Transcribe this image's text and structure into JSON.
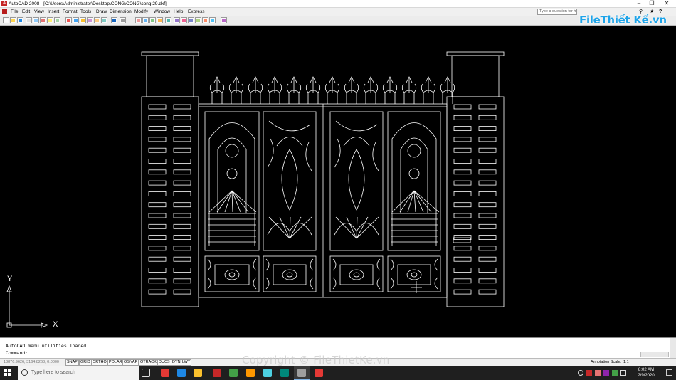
{
  "window": {
    "app_icon": "A",
    "title": "AutoCAD 2008 - [C:\\Users\\Administrator\\Desktop\\CONG\\CONG\\cong 29.dxf]",
    "minimize": "–",
    "restore": "❐",
    "close": "✕"
  },
  "menu": {
    "items": [
      "File",
      "Edit",
      "View",
      "Insert",
      "Format",
      "Tools",
      "Draw",
      "Dimension",
      "Modify",
      "Window",
      "Help",
      "Express"
    ],
    "help_search_placeholder": "Type a question for help"
  },
  "logo": {
    "text": "FileThiết Kế.vn"
  },
  "canvas": {
    "background": "#000000",
    "line_color": "#ffffff",
    "ucs_y": "Y",
    "ucs_x": "X"
  },
  "command": {
    "history": "AutoCAD menu utilities loaded.",
    "prompt": "Command:"
  },
  "status": {
    "coordinates": "13876.9626, 3164.8263, 0.0000",
    "toggles": [
      "SNAP",
      "GRID",
      "ORTHO",
      "POLAR",
      "OSNAP",
      "OTRACK",
      "DUCS",
      "DYN",
      "LWT"
    ],
    "annotation_scale_label": "Annotation Scale:",
    "annotation_scale_value": "1:1"
  },
  "taskbar": {
    "search_placeholder": "Type here to search",
    "time": "8:02 AM",
    "date": "2/9/2020",
    "app_colors": [
      "#e53935",
      "#1e88e5",
      "#fbc02d",
      "#c62828",
      "#43a047",
      "#ff9800",
      "#4dd0e1",
      "#00897b",
      "#9e9e9e"
    ]
  },
  "watermark": {
    "copyright": "Copyright © FileThietKe.vn"
  }
}
